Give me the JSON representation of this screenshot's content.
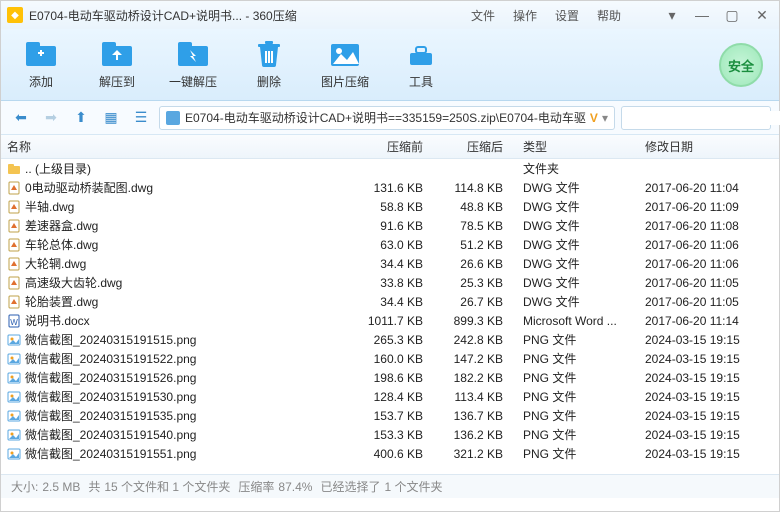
{
  "window": {
    "title": "E0704-电动车驱动桥设计CAD+说明书... - 360压缩"
  },
  "menu": {
    "file": "文件",
    "operate": "操作",
    "settings": "设置",
    "help": "帮助"
  },
  "toolbar": {
    "add": "添加",
    "extract": "解压到",
    "oneclick": "一键解压",
    "delete": "删除",
    "imgcompress": "图片压缩",
    "tools": "工具",
    "safe": "安全"
  },
  "path": {
    "text": "E0704-电动车驱动桥设计CAD+说明书==335159=250S.zip\\E0704-电动车驱",
    "vip": "V"
  },
  "columns": {
    "name": "名称",
    "before": "压缩前",
    "after": "压缩后",
    "type": "类型",
    "date": "修改日期"
  },
  "files": [
    {
      "icon": "folder",
      "name": ".. (上级目录)",
      "before": "",
      "after": "",
      "type": "文件夹",
      "date": ""
    },
    {
      "icon": "dwg",
      "name": "0电动驱动桥装配图.dwg",
      "before": "131.6 KB",
      "after": "114.8 KB",
      "type": "DWG 文件",
      "date": "2017-06-20 11:04"
    },
    {
      "icon": "dwg",
      "name": "半轴.dwg",
      "before": "58.8 KB",
      "after": "48.8 KB",
      "type": "DWG 文件",
      "date": "2017-06-20 11:09"
    },
    {
      "icon": "dwg",
      "name": "差速器盒.dwg",
      "before": "91.6 KB",
      "after": "78.5 KB",
      "type": "DWG 文件",
      "date": "2017-06-20 11:08"
    },
    {
      "icon": "dwg",
      "name": "车轮总体.dwg",
      "before": "63.0 KB",
      "after": "51.2 KB",
      "type": "DWG 文件",
      "date": "2017-06-20 11:06"
    },
    {
      "icon": "dwg",
      "name": "大轮辋.dwg",
      "before": "34.4 KB",
      "after": "26.6 KB",
      "type": "DWG 文件",
      "date": "2017-06-20 11:06"
    },
    {
      "icon": "dwg",
      "name": "高速级大齿轮.dwg",
      "before": "33.8 KB",
      "after": "25.3 KB",
      "type": "DWG 文件",
      "date": "2017-06-20 11:05"
    },
    {
      "icon": "dwg",
      "name": "轮胎装置.dwg",
      "before": "34.4 KB",
      "after": "26.7 KB",
      "type": "DWG 文件",
      "date": "2017-06-20 11:05"
    },
    {
      "icon": "doc",
      "name": "说明书.docx",
      "before": "1011.7 KB",
      "after": "899.3 KB",
      "type": "Microsoft Word ...",
      "date": "2017-06-20 11:14"
    },
    {
      "icon": "png",
      "name": "微信截图_20240315191515.png",
      "before": "265.3 KB",
      "after": "242.8 KB",
      "type": "PNG 文件",
      "date": "2024-03-15 19:15"
    },
    {
      "icon": "png",
      "name": "微信截图_20240315191522.png",
      "before": "160.0 KB",
      "after": "147.2 KB",
      "type": "PNG 文件",
      "date": "2024-03-15 19:15"
    },
    {
      "icon": "png",
      "name": "微信截图_20240315191526.png",
      "before": "198.6 KB",
      "after": "182.2 KB",
      "type": "PNG 文件",
      "date": "2024-03-15 19:15"
    },
    {
      "icon": "png",
      "name": "微信截图_20240315191530.png",
      "before": "128.4 KB",
      "after": "113.4 KB",
      "type": "PNG 文件",
      "date": "2024-03-15 19:15"
    },
    {
      "icon": "png",
      "name": "微信截图_20240315191535.png",
      "before": "153.7 KB",
      "after": "136.7 KB",
      "type": "PNG 文件",
      "date": "2024-03-15 19:15"
    },
    {
      "icon": "png",
      "name": "微信截图_20240315191540.png",
      "before": "153.3 KB",
      "after": "136.2 KB",
      "type": "PNG 文件",
      "date": "2024-03-15 19:15"
    },
    {
      "icon": "png",
      "name": "微信截图_20240315191551.png",
      "before": "400.6 KB",
      "after": "321.2 KB",
      "type": "PNG 文件",
      "date": "2024-03-15 19:15"
    }
  ],
  "status": {
    "size_label": "大小:",
    "size": "2.5 MB",
    "count_label": "共",
    "count": "15 个文件和 1 个文件夹",
    "ratio_label": "压缩率",
    "ratio": "87.4%",
    "selected_label": "已经选择了",
    "selected": "1 个文件夹"
  }
}
